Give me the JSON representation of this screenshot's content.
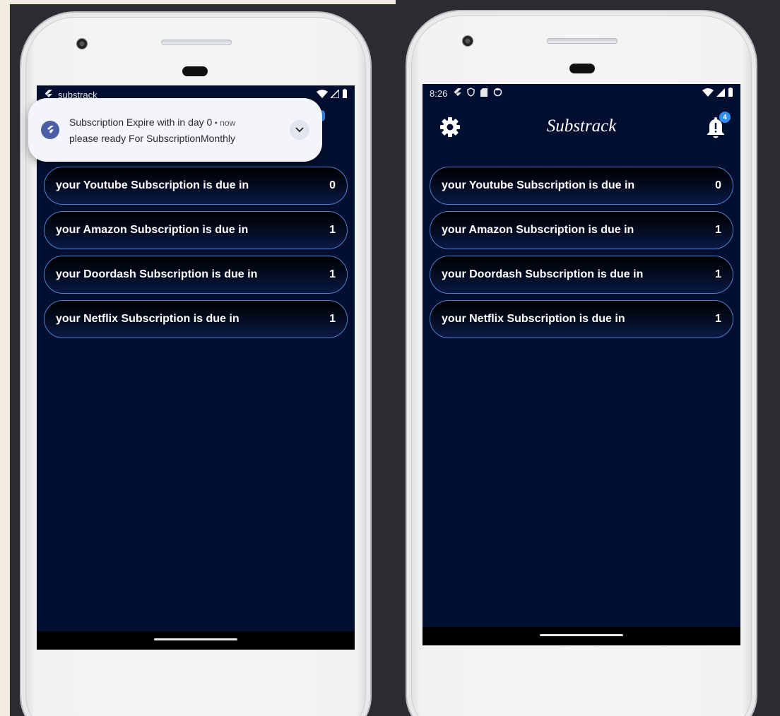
{
  "left_phone": {
    "statusbar": {
      "app_name": "substrack"
    },
    "notification": {
      "title": "Subscription Expire with in day 0",
      "separator": " • ",
      "time": "now",
      "body": "please ready For SubscriptionMonthly",
      "app_icon": "flutter-icon"
    },
    "subscriptions": [
      {
        "label": "your Youtube Subscription is due in",
        "count": "0"
      },
      {
        "label": "your Amazon Subscription is due in",
        "count": "1"
      },
      {
        "label": "your Doordash Subscription is due in",
        "count": "1"
      },
      {
        "label": "your Netflix Subscription is due in",
        "count": "1"
      }
    ]
  },
  "right_phone": {
    "statusbar": {
      "time": "8:26"
    },
    "appbar": {
      "title": "Substrack",
      "badge_count": "4"
    },
    "subscriptions": [
      {
        "label": "your Youtube Subscription is due in",
        "count": "0"
      },
      {
        "label": "your Amazon Subscription is due in",
        "count": "1"
      },
      {
        "label": "your Doordash Subscription is due in",
        "count": "1"
      },
      {
        "label": "your Netflix Subscription is due in",
        "count": "1"
      }
    ]
  },
  "colors": {
    "screen_bg": "#020f30",
    "item_border": "#4f7fc9",
    "badge": "#2f8ff0",
    "notification_bg": "#f4f5fb"
  }
}
